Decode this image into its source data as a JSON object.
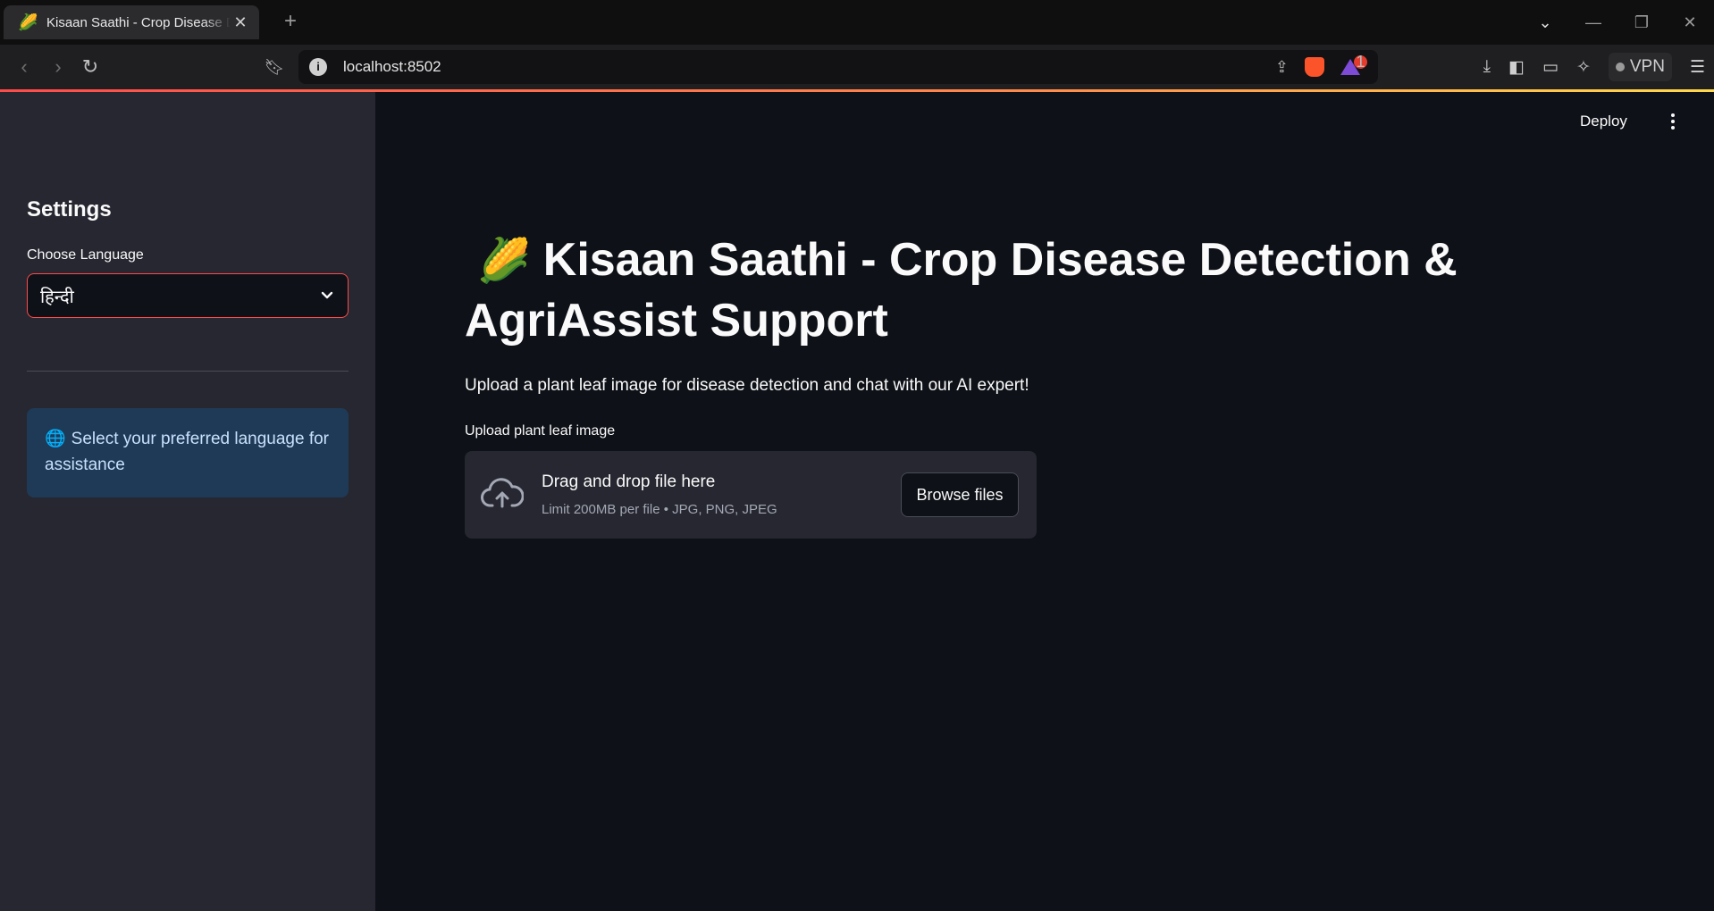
{
  "browser": {
    "tab_title": "Kisaan Saathi - Crop Disease Detection & AgriAssist Support",
    "tab_icon": "🌽",
    "url": "localhost:8502",
    "vpn_label": "VPN",
    "notification_count": "1"
  },
  "header": {
    "deploy_label": "Deploy"
  },
  "sidebar": {
    "title": "Settings",
    "language_label": "Choose Language",
    "language_selected": "हिन्दी",
    "info_icon": "🌐",
    "info_text": "Select your preferred language for assistance"
  },
  "main": {
    "title_emoji": "🌽",
    "title": "Kisaan Saathi - Crop Disease Detection & AgriAssist Support",
    "subtitle": "Upload a plant leaf image for disease detection and chat with our AI expert!",
    "uploader": {
      "label": "Upload plant leaf image",
      "drop_text": "Drag and drop file here",
      "limit_text": "Limit 200MB per file • JPG, PNG, JPEG",
      "browse_label": "Browse files"
    }
  },
  "colors": {
    "background": "#0e1117",
    "sidebar": "#262730",
    "accent": "#ff4b4b",
    "info_bg": "#1f3a57",
    "info_text": "#c7e0fb"
  }
}
